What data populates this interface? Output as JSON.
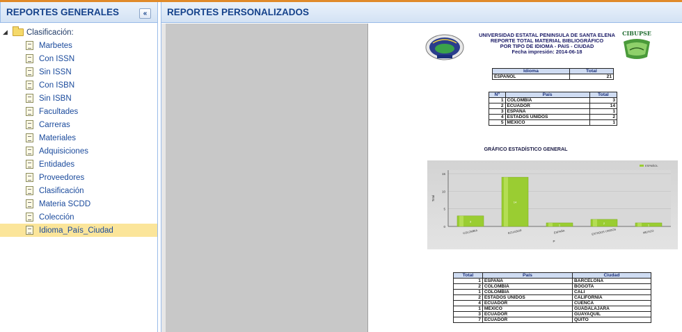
{
  "left_panel": {
    "title": "REPORTES GENERALES",
    "collapse_label": "«",
    "tree": {
      "root_label": "Clasificación:",
      "items": [
        "Marbetes",
        "Con ISSN",
        "Sin ISSN",
        "Con ISBN",
        "Sin ISBN",
        "Facultades",
        "Carreras",
        "Materiales",
        "Adquisiciones",
        "Entidades",
        "Proveedores",
        "Clasificación",
        "Materia SCDD",
        "Colección",
        "Idioma_País_Ciudad"
      ],
      "selected": "Idioma_País_Ciudad"
    }
  },
  "right_panel": {
    "title": "REPORTES PERSONALIZADOS"
  },
  "report": {
    "header": {
      "line1": "UNIVERSIDAD ESTATAL PENINSULA DE SANTA ELENA",
      "line2": "REPORTE TOTAL MATERIAL BIBLIOGRÁFICO",
      "line3": "POR TIPO DE IDIOMA - PAIS - CIUDAD",
      "line4": "Fecha impresión: 2014-06-18",
      "right_logo_text": "CIBUPSE"
    },
    "idioma_table": {
      "headers": [
        "Idioma",
        "Total"
      ],
      "rows": [
        [
          "ESPAÑOL",
          "21"
        ]
      ]
    },
    "pais_table": {
      "headers": [
        "Nº",
        "País",
        "Total"
      ],
      "rows": [
        [
          "1",
          "COLOMBIA",
          "3"
        ],
        [
          "2",
          "ECUADOR",
          "14"
        ],
        [
          "3",
          "ESPAÑA",
          "1"
        ],
        [
          "4",
          "ESTADOS UNIDOS",
          "2"
        ],
        [
          "5",
          "MEXICO",
          "1"
        ]
      ]
    },
    "chart_title": "GRÁFICO ESTADÍSTICO GENERAL",
    "ciudad_table": {
      "headers": [
        "Total",
        "País",
        "Ciudad"
      ],
      "rows": [
        [
          "1",
          "ESPAÑA",
          "BARCELONA"
        ],
        [
          "2",
          "COLOMBIA",
          "BOGOTA"
        ],
        [
          "1",
          "COLOMBIA",
          "CALI"
        ],
        [
          "2",
          "ESTADOS UNIDOS",
          "CALIFORNIA"
        ],
        [
          "4",
          "ECUADOR",
          "CUENCA"
        ],
        [
          "1",
          "MEXICO",
          "GUADALAJARA"
        ],
        [
          "3",
          "ECUADOR",
          "GUAYAQUIL"
        ],
        [
          "7",
          "ECUADOR",
          "QUITO"
        ]
      ]
    }
  },
  "chart_data": {
    "type": "bar",
    "categories": [
      "COLOMBIA",
      "ECUADOR",
      "ESPAÑA",
      "ESTADOS UNIDOS",
      "MEXICO"
    ],
    "series": [
      {
        "name": "ESPAÑOL",
        "values": [
          3,
          14,
          1,
          2,
          1
        ]
      }
    ],
    "title": "GRÁFICO ESTADÍSTICO GENERAL",
    "xlabel": "P",
    "ylabel": "Total",
    "yticks": [
      "0",
      "5",
      "10",
      "15"
    ],
    "ylim": [
      0,
      16
    ],
    "grid": true,
    "legend": "top-right",
    "bar_color": "#9acd32"
  },
  "colors": {
    "accent_orange": "#e08a2a",
    "header_text": "#15428b",
    "selected_row": "#fbe59a"
  }
}
